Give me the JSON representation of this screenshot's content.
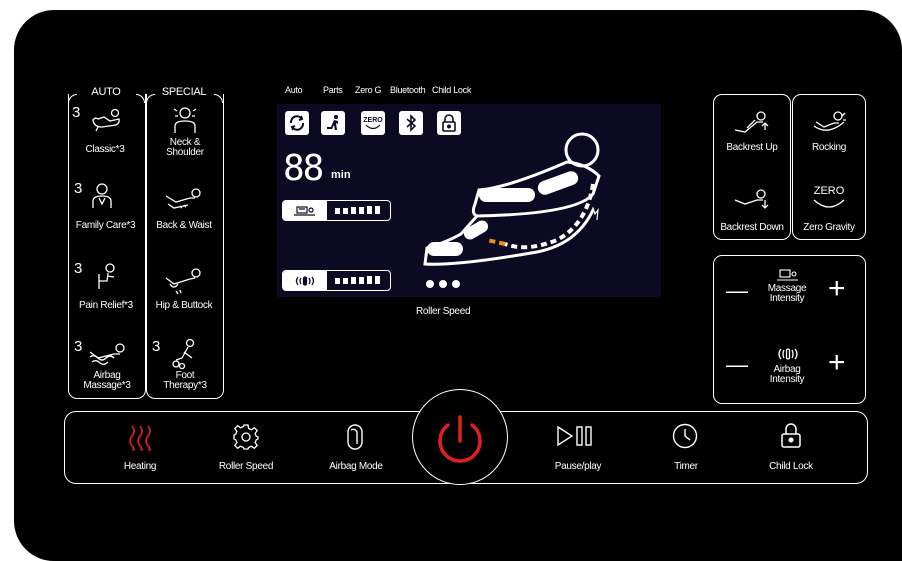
{
  "colors": {
    "panel": "#000000",
    "screen": "#0b0a22",
    "accent_red": "#e02020",
    "accent_orange": "#f0901a"
  },
  "auto": {
    "title": "AUTO",
    "items": [
      {
        "count": "3",
        "label": "Classic*3",
        "icon": "recline-chair-icon"
      },
      {
        "count": "3",
        "label": "Family Care*3",
        "icon": "person-icon"
      },
      {
        "count": "3",
        "label": "Pain Relief*3",
        "icon": "seated-person-icon"
      },
      {
        "count": "3",
        "label": "Airbag Massage*3",
        "icon": "airbag-massage-icon"
      }
    ]
  },
  "special": {
    "title": "SPECIAL",
    "items": [
      {
        "count": "",
        "label": "Neck & Shoulder",
        "icon": "neck-shoulder-icon"
      },
      {
        "count": "",
        "label": "Back & Waist",
        "icon": "back-waist-icon"
      },
      {
        "count": "",
        "label": "Hip & Buttock",
        "icon": "hip-buttock-icon"
      },
      {
        "count": "3",
        "label": "Foot Therapy*3",
        "icon": "foot-therapy-icon"
      }
    ]
  },
  "screen": {
    "tabs": [
      "Auto",
      "Parts",
      "Zero G",
      "Bluetooth",
      "Child Lock"
    ],
    "timer_value": "88",
    "timer_unit": "min",
    "zero_badge": "ZERO",
    "roller_caption": "Roller Speed",
    "massage_level": 6,
    "airbag_level": 6
  },
  "right": {
    "backrest_up": "Backrest Up",
    "backrest_down": "Backrest Down",
    "rocking": "Rocking",
    "zero_word": "ZERO",
    "zero_gravity": "Zero Gravity",
    "massage_intensity": "Massage Intensity",
    "airbag_intensity": "Airbag Intensity",
    "minus": "—",
    "plus": "+"
  },
  "bottom": {
    "heating": "Heating",
    "roller_speed": "Roller Speed",
    "airbag_mode": "Airbag Mode",
    "pause_play": "Pause/play",
    "timer": "Timer",
    "child_lock": "Child Lock"
  }
}
